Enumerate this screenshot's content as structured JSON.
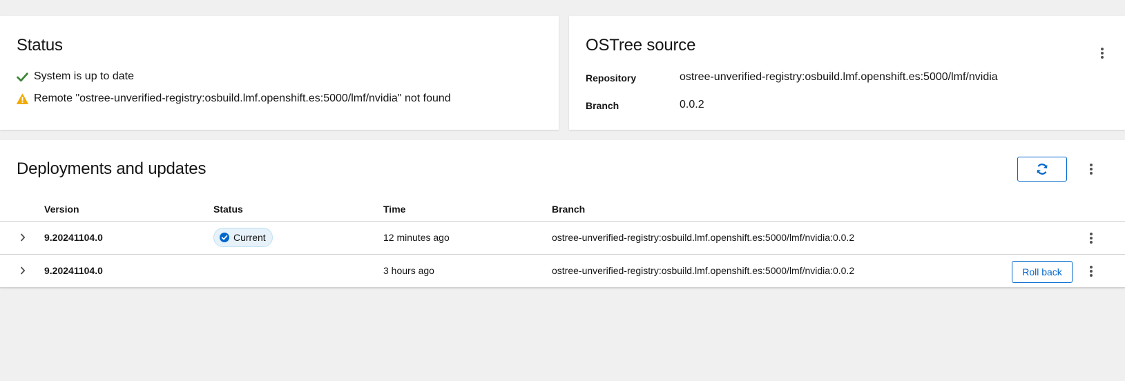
{
  "status_card": {
    "title": "Status",
    "ok_message": "System is up to date",
    "warning_message": "Remote \"ostree-unverified-registry:osbuild.lmf.openshift.es:5000/lmf/nvidia\" not found",
    "ok_color": "#3e8635",
    "warning_color": "#f0ab00"
  },
  "ostree_card": {
    "title": "OSTree source",
    "repository_label": "Repository",
    "repository_value": "ostree-unverified-registry:osbuild.lmf.openshift.es:5000/lmf/nvidia",
    "branch_label": "Branch",
    "branch_value": "0.0.2",
    "menu_icon": "kebab-icon"
  },
  "deployments": {
    "title": "Deployments and updates",
    "refresh_icon": "refresh-icon",
    "accent_color": "#0066cc",
    "columns": [
      "Version",
      "Status",
      "Time",
      "Branch"
    ],
    "rows": [
      {
        "version": "9.20241104.0",
        "status": "Current",
        "time": "12 minutes ago",
        "branch": "ostree-unverified-registry:osbuild.lmf.openshift.es:5000/lmf/nvidia:0.0.2",
        "action": ""
      },
      {
        "version": "9.20241104.0",
        "status": "",
        "time": "3 hours ago",
        "branch": "ostree-unverified-registry:osbuild.lmf.openshift.es:5000/lmf/nvidia:0.0.2",
        "action": "Roll back"
      }
    ]
  }
}
